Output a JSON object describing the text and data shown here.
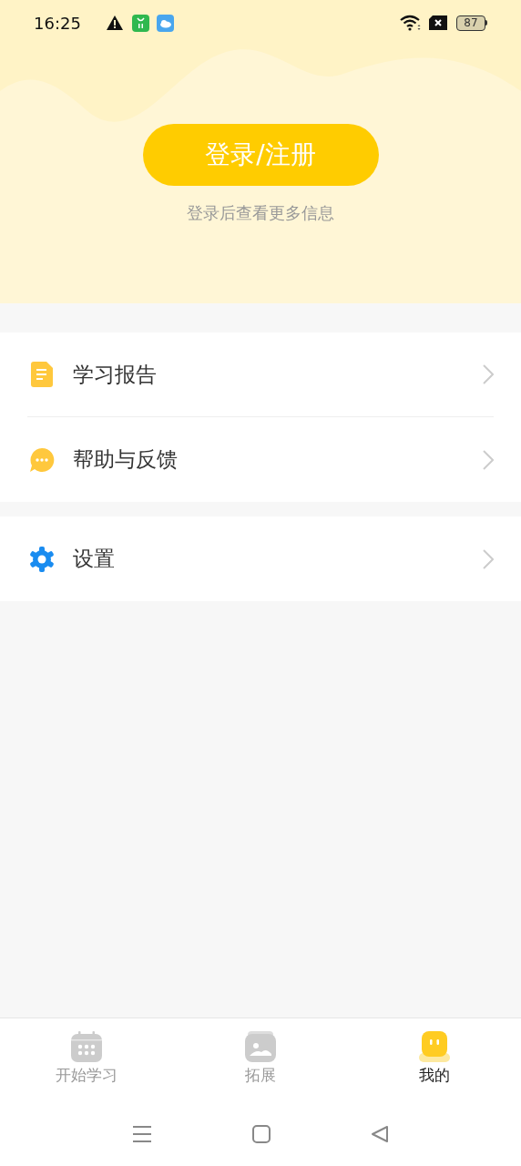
{
  "status_bar": {
    "time": "16:25",
    "battery": "87"
  },
  "header": {
    "login_button": "登录/注册",
    "hint": "登录后查看更多信息"
  },
  "menu_groups": [
    {
      "items": [
        {
          "kind": "report",
          "label": "学习报告"
        },
        {
          "kind": "help",
          "label": "帮助与反馈"
        }
      ]
    },
    {
      "items": [
        {
          "kind": "settings",
          "label": "设置"
        }
      ]
    }
  ],
  "tabs": [
    {
      "kind": "calendar",
      "label": "开始学习",
      "selected": false
    },
    {
      "kind": "image",
      "label": "拓展",
      "selected": false
    },
    {
      "kind": "face",
      "label": "我的",
      "selected": true
    }
  ]
}
